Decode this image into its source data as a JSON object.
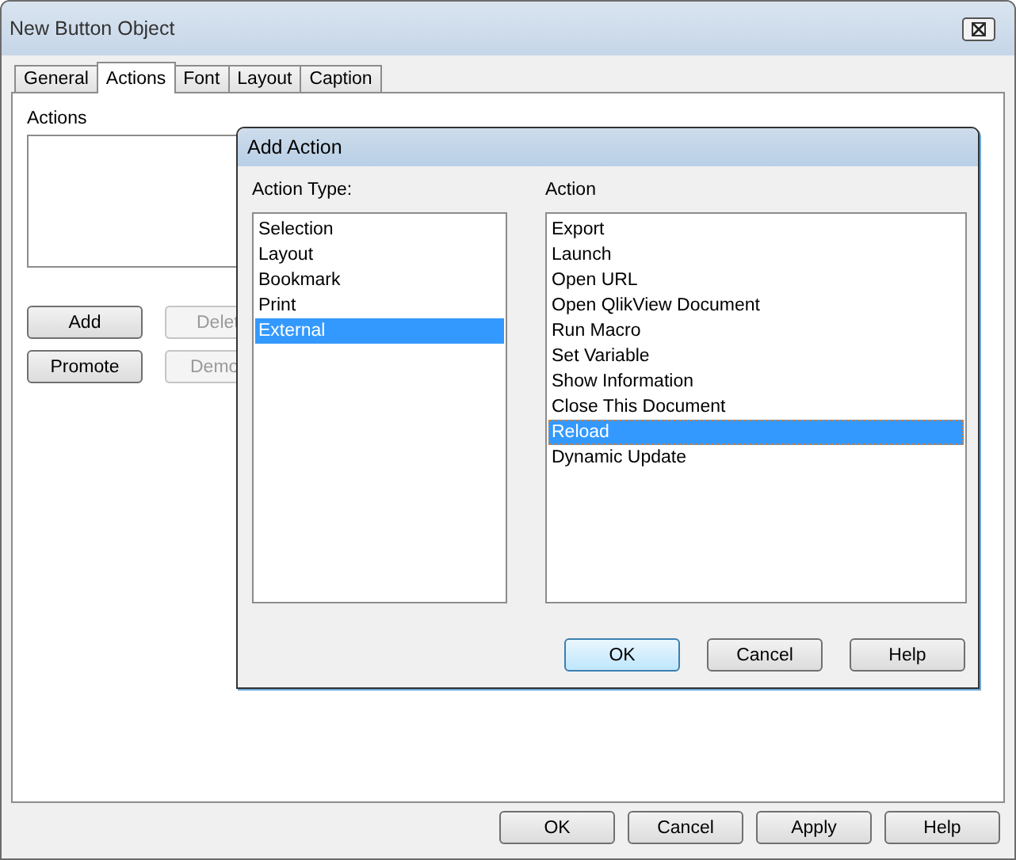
{
  "window": {
    "title": "New Button Object"
  },
  "tabs": [
    {
      "label": "General",
      "selected": false
    },
    {
      "label": "Actions",
      "selected": true
    },
    {
      "label": "Font",
      "selected": false
    },
    {
      "label": "Layout",
      "selected": false
    },
    {
      "label": "Caption",
      "selected": false
    }
  ],
  "actions_panel": {
    "label": "Actions",
    "buttons": [
      {
        "label": "Add",
        "disabled": false
      },
      {
        "label": "Delet",
        "disabled": true
      },
      {
        "label": "Promote",
        "disabled": false
      },
      {
        "label": "Demo",
        "disabled": true
      }
    ]
  },
  "dialog": {
    "title": "Add Action",
    "action_type_label": "Action Type:",
    "action_label": "Action",
    "action_types": [
      {
        "label": "Selection",
        "selected": false
      },
      {
        "label": "Layout",
        "selected": false
      },
      {
        "label": "Bookmark",
        "selected": false
      },
      {
        "label": "Print",
        "selected": false
      },
      {
        "label": "External",
        "selected": true
      }
    ],
    "actions": [
      {
        "label": "Export",
        "selected": false
      },
      {
        "label": "Launch",
        "selected": false
      },
      {
        "label": "Open URL",
        "selected": false
      },
      {
        "label": "Open QlikView Document",
        "selected": false
      },
      {
        "label": "Run Macro",
        "selected": false
      },
      {
        "label": "Set Variable",
        "selected": false
      },
      {
        "label": "Show Information",
        "selected": false
      },
      {
        "label": "Close This Document",
        "selected": false
      },
      {
        "label": "Reload",
        "selected": true
      },
      {
        "label": "Dynamic Update",
        "selected": false
      }
    ],
    "buttons": [
      {
        "label": "OK",
        "default": true
      },
      {
        "label": "Cancel",
        "default": false
      },
      {
        "label": "Help",
        "default": false
      }
    ]
  },
  "buttons": [
    "OK",
    "Cancel",
    "Apply",
    "Help"
  ]
}
